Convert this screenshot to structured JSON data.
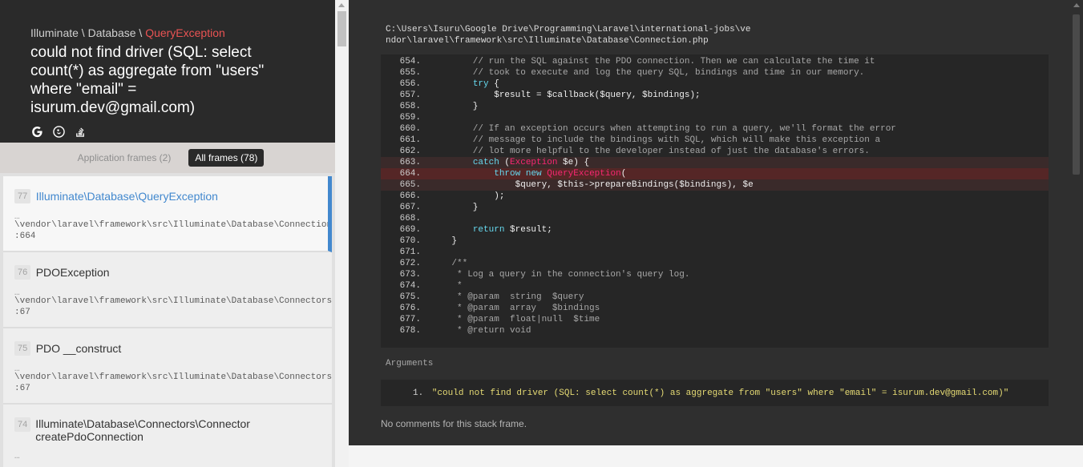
{
  "exception": {
    "namespace": "Illuminate \\ Database \\ ",
    "class_short": "QueryException",
    "message": "could not find driver (SQL: select count(*) as aggregate from \"users\" where \"email\" = isurum.dev@gmail.com)"
  },
  "search_icons": [
    "google-icon",
    "duckduckgo-icon",
    "stackoverflow-icon"
  ],
  "filters": {
    "application": "Application frames (2)",
    "all": "All frames (78)"
  },
  "frames": [
    {
      "num": "77",
      "class": "Illuminate\\Database\\QueryException",
      "ellipsis": "…",
      "file": "\\vendor\\laravel\\framework\\src\\Illuminate\\Database\\Connection.php",
      "line": ":664"
    },
    {
      "num": "76",
      "class": "PDOException",
      "ellipsis": "…",
      "file": "\\vendor\\laravel\\framework\\src\\Illuminate\\Database\\Connectors\\Connector.php",
      "line": ":67"
    },
    {
      "num": "75",
      "class": "PDO __construct",
      "ellipsis": "…",
      "file": "\\vendor\\laravel\\framework\\src\\Illuminate\\Database\\Connectors\\Connector.php",
      "line": ":67"
    },
    {
      "num": "74",
      "class_line1": "Illuminate\\Database\\Connectors\\Connector",
      "class_line2": "createPdoConnection",
      "ellipsis": "…"
    }
  ],
  "code": {
    "path": "C:\\Users\\Isuru\\Google Drive\\Programming\\Laravel\\international-jobs\\vendor\\laravel\\framework\\src\\Illuminate\\Database\\Connection.php",
    "lines": [
      {
        "n": "654.",
        "t": "        // run the SQL against the PDO connection. Then we can calculate the time it"
      },
      {
        "n": "655.",
        "t": "        // took to execute and log the query SQL, bindings and time in our memory."
      },
      {
        "n": "656.",
        "t": "        try {"
      },
      {
        "n": "657.",
        "t": "            $result = $callback($query, $bindings);"
      },
      {
        "n": "658.",
        "t": "        }"
      },
      {
        "n": "659.",
        "t": ""
      },
      {
        "n": "660.",
        "t": "        // If an exception occurs when attempting to run a query, we'll format the error"
      },
      {
        "n": "661.",
        "t": "        // message to include the bindings with SQL, which will make this exception a"
      },
      {
        "n": "662.",
        "t": "        // lot more helpful to the developer instead of just the database's errors."
      },
      {
        "n": "663.",
        "t": "        catch (Exception $e) {"
      },
      {
        "n": "664.",
        "t": "            throw new QueryException("
      },
      {
        "n": "665.",
        "t": "                $query, $this->prepareBindings($bindings), $e"
      },
      {
        "n": "666.",
        "t": "            );"
      },
      {
        "n": "667.",
        "t": "        }"
      },
      {
        "n": "668.",
        "t": ""
      },
      {
        "n": "669.",
        "t": "        return $result;"
      },
      {
        "n": "670.",
        "t": "    }"
      },
      {
        "n": "671.",
        "t": ""
      },
      {
        "n": "672.",
        "t": "    /**"
      },
      {
        "n": "673.",
        "t": "     * Log a query in the connection's query log."
      },
      {
        "n": "674.",
        "t": "     *"
      },
      {
        "n": "675.",
        "t": "     * @param  string  $query"
      },
      {
        "n": "676.",
        "t": "     * @param  array   $bindings"
      },
      {
        "n": "677.",
        "t": "     * @param  float|null  $time"
      },
      {
        "n": "678.",
        "t": "     * @return void"
      }
    ]
  },
  "arguments": {
    "label": "Arguments",
    "items": [
      {
        "num": "1.",
        "value": "\"could not find driver (SQL: select count(*) as aggregate from \"users\" where \"email\" = isurum.dev@gmail.com)\""
      }
    ]
  },
  "no_comments": "No comments for this stack frame."
}
